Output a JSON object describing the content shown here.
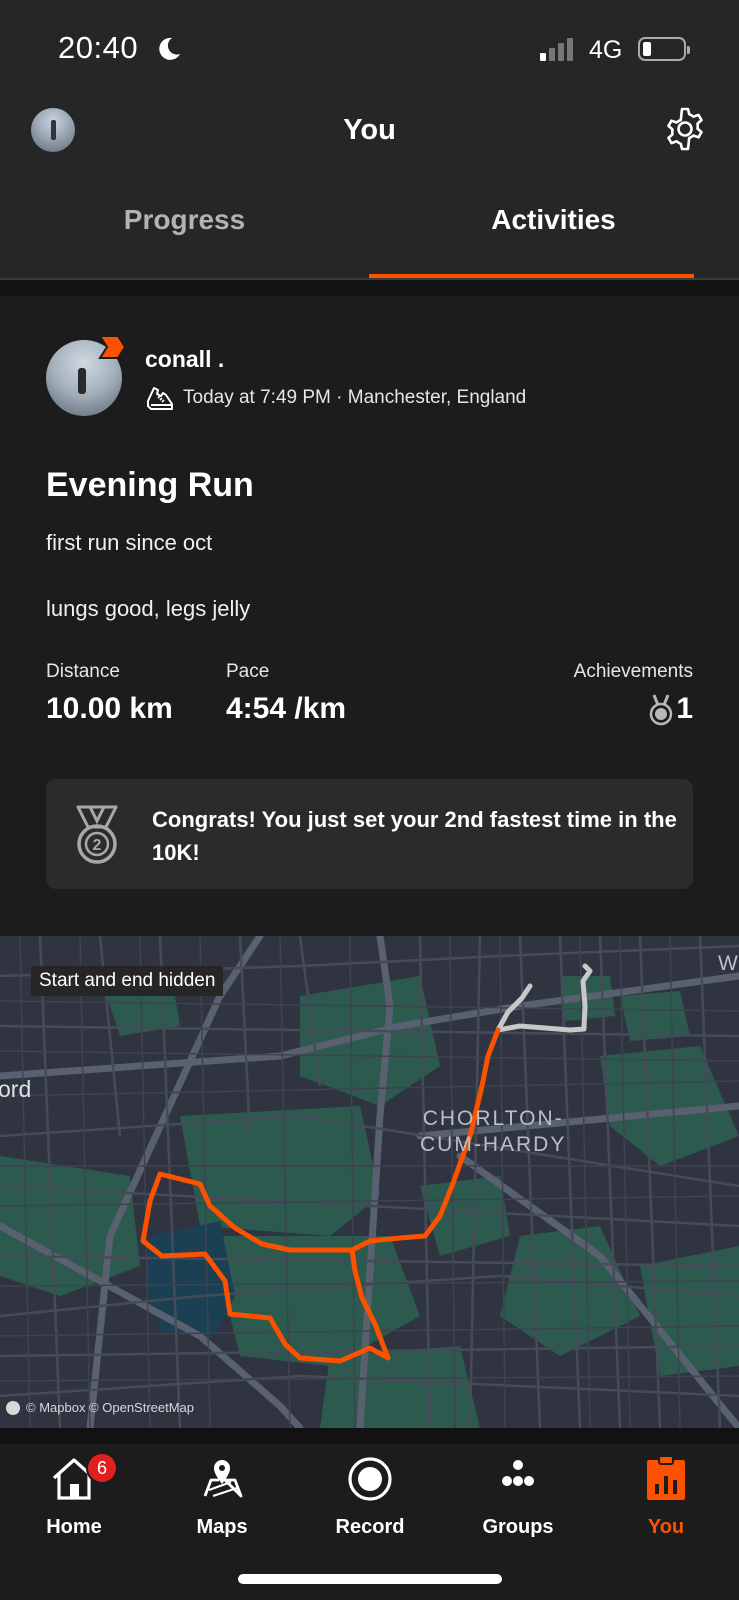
{
  "status_bar": {
    "time": "20:40",
    "network": "4G"
  },
  "header": {
    "title": "You"
  },
  "tabs": [
    {
      "label": "Progress",
      "active": false
    },
    {
      "label": "Activities",
      "active": true
    }
  ],
  "activity": {
    "athlete_name": "conall .",
    "meta": "Today at 7:49 PM · Manchester, England",
    "title": "Evening Run",
    "description_lines": [
      "first run since oct",
      "lungs good, legs jelly"
    ],
    "stats": {
      "distance": {
        "label": "Distance",
        "value": "10.00 km"
      },
      "pace": {
        "label": "Pace",
        "value": "4:54 /km"
      },
      "achievements": {
        "label": "Achievements",
        "value": "1"
      }
    },
    "congrats_text": "Congrats! You just set your 2nd fastest time in the 10K!"
  },
  "map": {
    "overlay_label": "Start and end hidden",
    "place_name": "CHORLTON-\nCUM-HARDY",
    "edge_label_left": "ord",
    "edge_label_right": "W",
    "attribution": "© Mapbox © OpenStreetMap",
    "route_color": "#fc5200"
  },
  "bottom_nav": [
    {
      "label": "Home",
      "icon": "home-icon",
      "badge": "6",
      "active": false
    },
    {
      "label": "Maps",
      "icon": "map-icon",
      "active": false
    },
    {
      "label": "Record",
      "icon": "record-icon",
      "active": false
    },
    {
      "label": "Groups",
      "icon": "groups-icon",
      "active": false
    },
    {
      "label": "You",
      "icon": "you-icon",
      "active": true
    }
  ],
  "colors": {
    "accent": "#fc5200",
    "background": "#121212",
    "card": "#1c1c1c",
    "header": "#262626"
  }
}
